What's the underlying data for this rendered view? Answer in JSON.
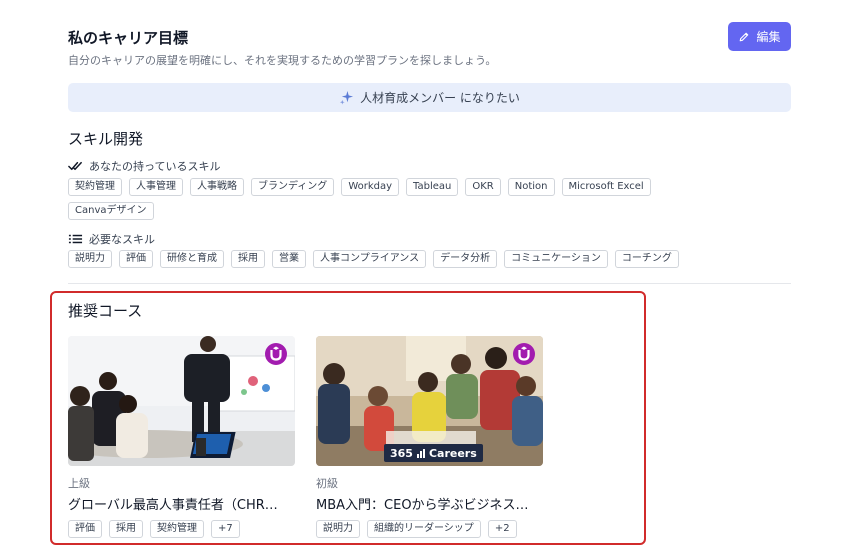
{
  "header": {
    "title": "私のキャリア目標",
    "subtitle": "自分のキャリアの展望を明確にし、それを実現するための学習プランを探しましょう。",
    "edit_label": "編集"
  },
  "goal": {
    "text": "人材育成メンバー になりたい"
  },
  "skills": {
    "section_title": "スキル開発",
    "owned_label": "あなたの持っているスキル",
    "owned": [
      "契約管理",
      "人事管理",
      "人事戦略",
      "ブランディング",
      "Workday",
      "Tableau",
      "OKR",
      "Notion",
      "Microsoft Excel",
      "Canvaデザイン"
    ],
    "needed_label": "必要なスキル",
    "needed": [
      "説明力",
      "評価",
      "研修と育成",
      "採用",
      "営業",
      "人事コンプライアンス",
      "データ分析",
      "コミュニケーション",
      "コーチング"
    ]
  },
  "recommended": {
    "title": "推奨コース",
    "courses": [
      {
        "level": "上級",
        "name": "グローバル最高人事責任者（CHR…",
        "tags": [
          "評価",
          "採用",
          "契約管理",
          "+7"
        ]
      },
      {
        "level": "初級",
        "name": "MBA入門：CEOから学ぶビジネス…",
        "tags": [
          "説明力",
          "組織的リーダーシップ",
          "+2"
        ],
        "logo_text": "365",
        "logo_brand": "Careers"
      }
    ]
  },
  "colors": {
    "accent": "#6366f1",
    "banner_bg": "#e8eefb",
    "highlight_border": "#d12b2b",
    "u_badge": "#a21caf"
  },
  "icons": {
    "edit": "pencil-icon",
    "goal": "sparkle-icon",
    "owned": "double-check-icon",
    "needed": "list-icon",
    "course_badge": "u-logo-icon"
  }
}
